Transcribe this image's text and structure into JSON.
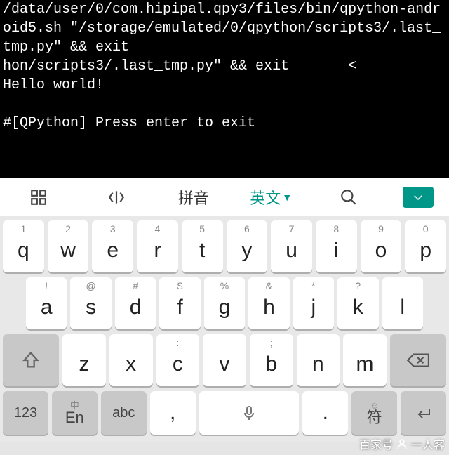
{
  "terminal": {
    "lines": "/data/user/0/com.hipipal.qpy3/files/bin/qpython-android5.sh \"/storage/emulated/0/qpython/scripts3/.last_tmp.py\" && exit\nhon/scripts3/.last_tmp.py\" && exit       <\nHello world!\n\n#[QPython] Press enter to exit"
  },
  "toolbar": {
    "mode_pinyin": "拼音",
    "mode_english": "英文"
  },
  "keys": {
    "row1": [
      {
        "sup": "1",
        "main": "q"
      },
      {
        "sup": "2",
        "main": "w"
      },
      {
        "sup": "3",
        "main": "e"
      },
      {
        "sup": "4",
        "main": "r"
      },
      {
        "sup": "5",
        "main": "t"
      },
      {
        "sup": "6",
        "main": "y"
      },
      {
        "sup": "7",
        "main": "u"
      },
      {
        "sup": "8",
        "main": "i"
      },
      {
        "sup": "9",
        "main": "o"
      },
      {
        "sup": "0",
        "main": "p"
      }
    ],
    "row2": [
      {
        "sup": "!",
        "main": "a"
      },
      {
        "sup": "@",
        "main": "s"
      },
      {
        "sup": "#",
        "main": "d"
      },
      {
        "sup": "$",
        "main": "f"
      },
      {
        "sup": "%",
        "main": "g"
      },
      {
        "sup": "&",
        "main": "h"
      },
      {
        "sup": "*",
        "main": "j"
      },
      {
        "sup": "?",
        "main": "k"
      },
      {
        "sup": "",
        "main": "l"
      }
    ],
    "row3": [
      {
        "sup": "",
        "main": "z"
      },
      {
        "sup": "",
        "main": "x"
      },
      {
        "sup": ":",
        "main": "c"
      },
      {
        "sup": "",
        "main": "v"
      },
      {
        "sup": ";",
        "main": "b"
      },
      {
        "sup": "",
        "main": "n"
      },
      {
        "sup": "",
        "main": "m"
      }
    ],
    "bottom": {
      "num": "123",
      "lang_top": "中",
      "lang_bot": "En",
      "abc": "abc",
      "comma": ",",
      "period": ".",
      "sym_top": "☺",
      "sym_bot": "符"
    }
  },
  "watermark": {
    "left": "百家号",
    "right": "一人客"
  }
}
